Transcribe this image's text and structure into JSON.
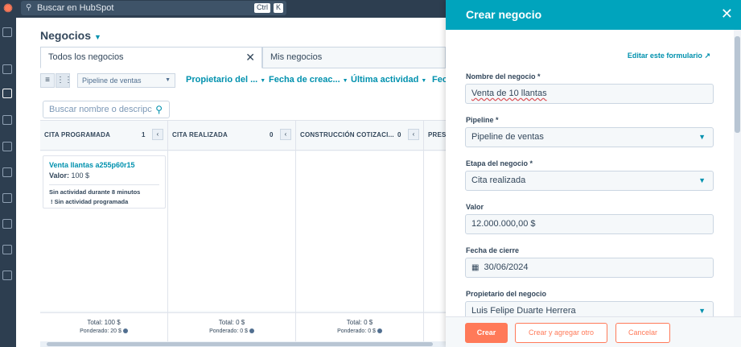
{
  "topbar": {
    "search_placeholder": "Buscar en HubSpot",
    "key_ctrl": "Ctrl",
    "key_k": "K"
  },
  "main": {
    "title": "Negocios",
    "tabs": [
      {
        "label": "Todos los negocios"
      },
      {
        "label": "Mis negocios"
      }
    ],
    "pipeline_select": "Pipeline de ventas",
    "filters": [
      "Propietario del ...",
      "Fecha de creac...",
      "Última actividad",
      "Fech"
    ],
    "board_search_placeholder": "Buscar nombre o descripc"
  },
  "board": {
    "columns": [
      {
        "name": "CITA PROGRAMADA",
        "count": "1",
        "total": "Total: 100 $",
        "weighted": "Ponderado: 20 $"
      },
      {
        "name": "CITA REALIZADA",
        "count": "0",
        "total": "Total: 0 $",
        "weighted": "Ponderado: 0 $"
      },
      {
        "name": "CONSTRUCCIÓN COTIZACI...",
        "count": "0",
        "total": "Total: 0 $",
        "weighted": "Ponderado: 0 $"
      },
      {
        "name": "PRESE",
        "count": "",
        "total": "",
        "weighted": ""
      }
    ],
    "card": {
      "name": "Venta llantas a255p60r15",
      "value_label": "Valor:",
      "value": "100 $",
      "activity": "Sin actividad durante 8 minutos",
      "scheduled": "! Sin actividad programada"
    }
  },
  "panel": {
    "title": "Crear negocio",
    "edit_form_link": "Editar este formulario",
    "fields": {
      "deal_name_label": "Nombre del negocio *",
      "deal_name_value": "Venta de 10 llantas",
      "pipeline_label": "Pipeline *",
      "pipeline_value": "Pipeline de ventas",
      "stage_label": "Etapa del negocio *",
      "stage_value": "Cita realizada",
      "amount_label": "Valor",
      "amount_value": "12.000.000,00 $",
      "close_date_label": "Fecha de cierre",
      "close_date_value": "30/06/2024",
      "owner_label": "Propietario del negocio",
      "owner_value": "Luis Felipe Duarte Herrera"
    },
    "buttons": {
      "create": "Crear",
      "create_another": "Crear y agregar otro",
      "cancel": "Cancelar"
    }
  },
  "colors": {
    "accent": "#00a4bd",
    "primary_button": "#ff7a59",
    "nav": "#2d3e50",
    "link": "#0091ae"
  }
}
